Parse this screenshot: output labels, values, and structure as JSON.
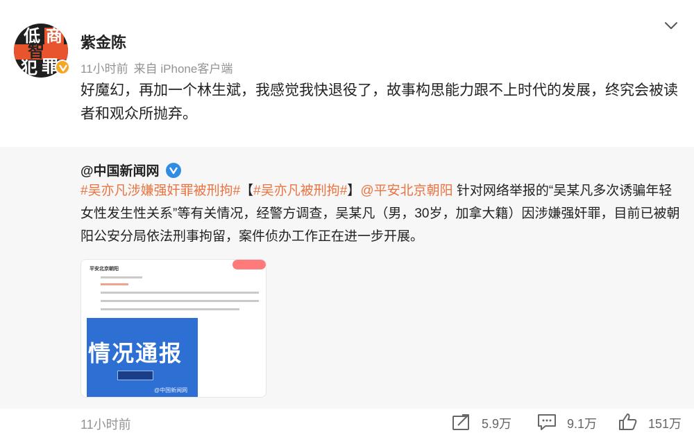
{
  "post": {
    "author": "紫金陈",
    "time": "11小时前",
    "source": "来自 iPhone客户端",
    "text": "好魔幻，再加一个林生斌，我感觉我快退役了，故事构思能力跟不上时代的发展，终究会被读者和观众所抛弃。",
    "avatar_chars": [
      "低",
      "智",
      "商",
      "犯",
      "罪"
    ]
  },
  "repost": {
    "author": "@中国新闻网",
    "segments": [
      {
        "text": "#吴亦凡涉嫌强奸罪被刑拘#",
        "type": "tag"
      },
      {
        "text": "【",
        "type": "plain"
      },
      {
        "text": "#吴亦凡被刑拘#",
        "type": "tag"
      },
      {
        "text": "】",
        "type": "plain"
      },
      {
        "text": "@平安北京朝阳",
        "type": "tag"
      },
      {
        "text": " 针对网络举报的“吴某凡多次诱骗年轻女性发生性关系”等有关情况，经警方调查，吴某凡（男，30岁，加拿大籍）因涉嫌强奸罪，目前已被朝阳公安分局依法刑事拘留，案件侦办工作正在进一步开展。",
        "type": "plain"
      }
    ],
    "thumbnail": {
      "account": "平安北京朝阳",
      "banner": "情况通报",
      "watermark": "@中国新闻网"
    }
  },
  "footer": {
    "time": "11小时前",
    "repost_count": "5.9万",
    "comment_count": "9.1万",
    "like_count": "151万"
  },
  "colors": {
    "tag": "#eb7340",
    "verified_orange": "#f6a623",
    "verified_blue": "#2f8de4",
    "repost_bg": "#f7f7f7"
  },
  "icons": [
    "chevron-down-icon",
    "verified-badge-icon",
    "repost-icon",
    "comment-icon",
    "like-icon"
  ]
}
